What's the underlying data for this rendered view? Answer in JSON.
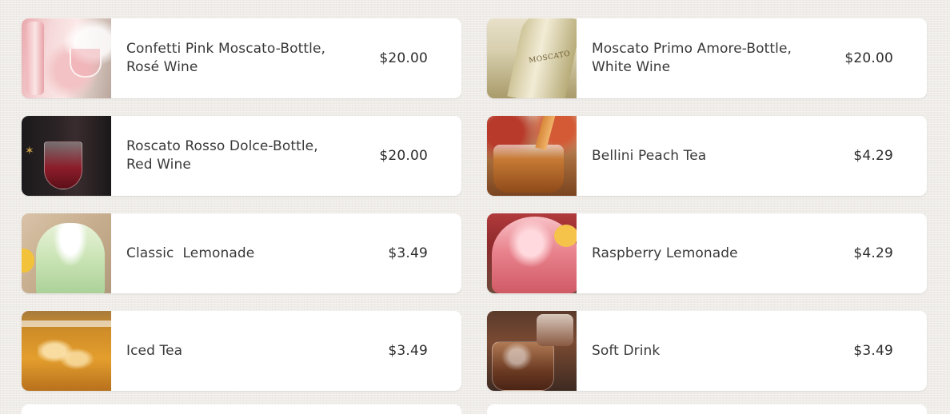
{
  "menu": {
    "items": [
      {
        "name": "Confetti Pink Moscato-Bottle,\nRosé Wine",
        "price": "$20.00",
        "image": "pink-moscato-image"
      },
      {
        "name": "Moscato Primo Amore-Bottle,\nWhite Wine",
        "price": "$20.00",
        "image": "moscato-primo-image"
      },
      {
        "name": "Roscato Rosso Dolce-Bottle,\nRed Wine",
        "price": "$20.00",
        "image": "roscato-rosso-image"
      },
      {
        "name": "Bellini Peach Tea",
        "price": "$4.29",
        "image": "peach-tea-image"
      },
      {
        "name": "Classic  Lemonade",
        "price": "$3.49",
        "image": "classic-lemonade-image"
      },
      {
        "name": "Raspberry Lemonade",
        "price": "$4.29",
        "image": "raspberry-lemonade-image"
      },
      {
        "name": "Iced Tea",
        "price": "$3.49",
        "image": "iced-tea-image"
      },
      {
        "name": "Soft Drink",
        "price": "$3.49",
        "image": "soft-drink-image"
      }
    ]
  },
  "colors": {
    "background": "#efece8",
    "card": "#ffffff",
    "text": "#3a3838",
    "price": "#2e2c2c"
  }
}
